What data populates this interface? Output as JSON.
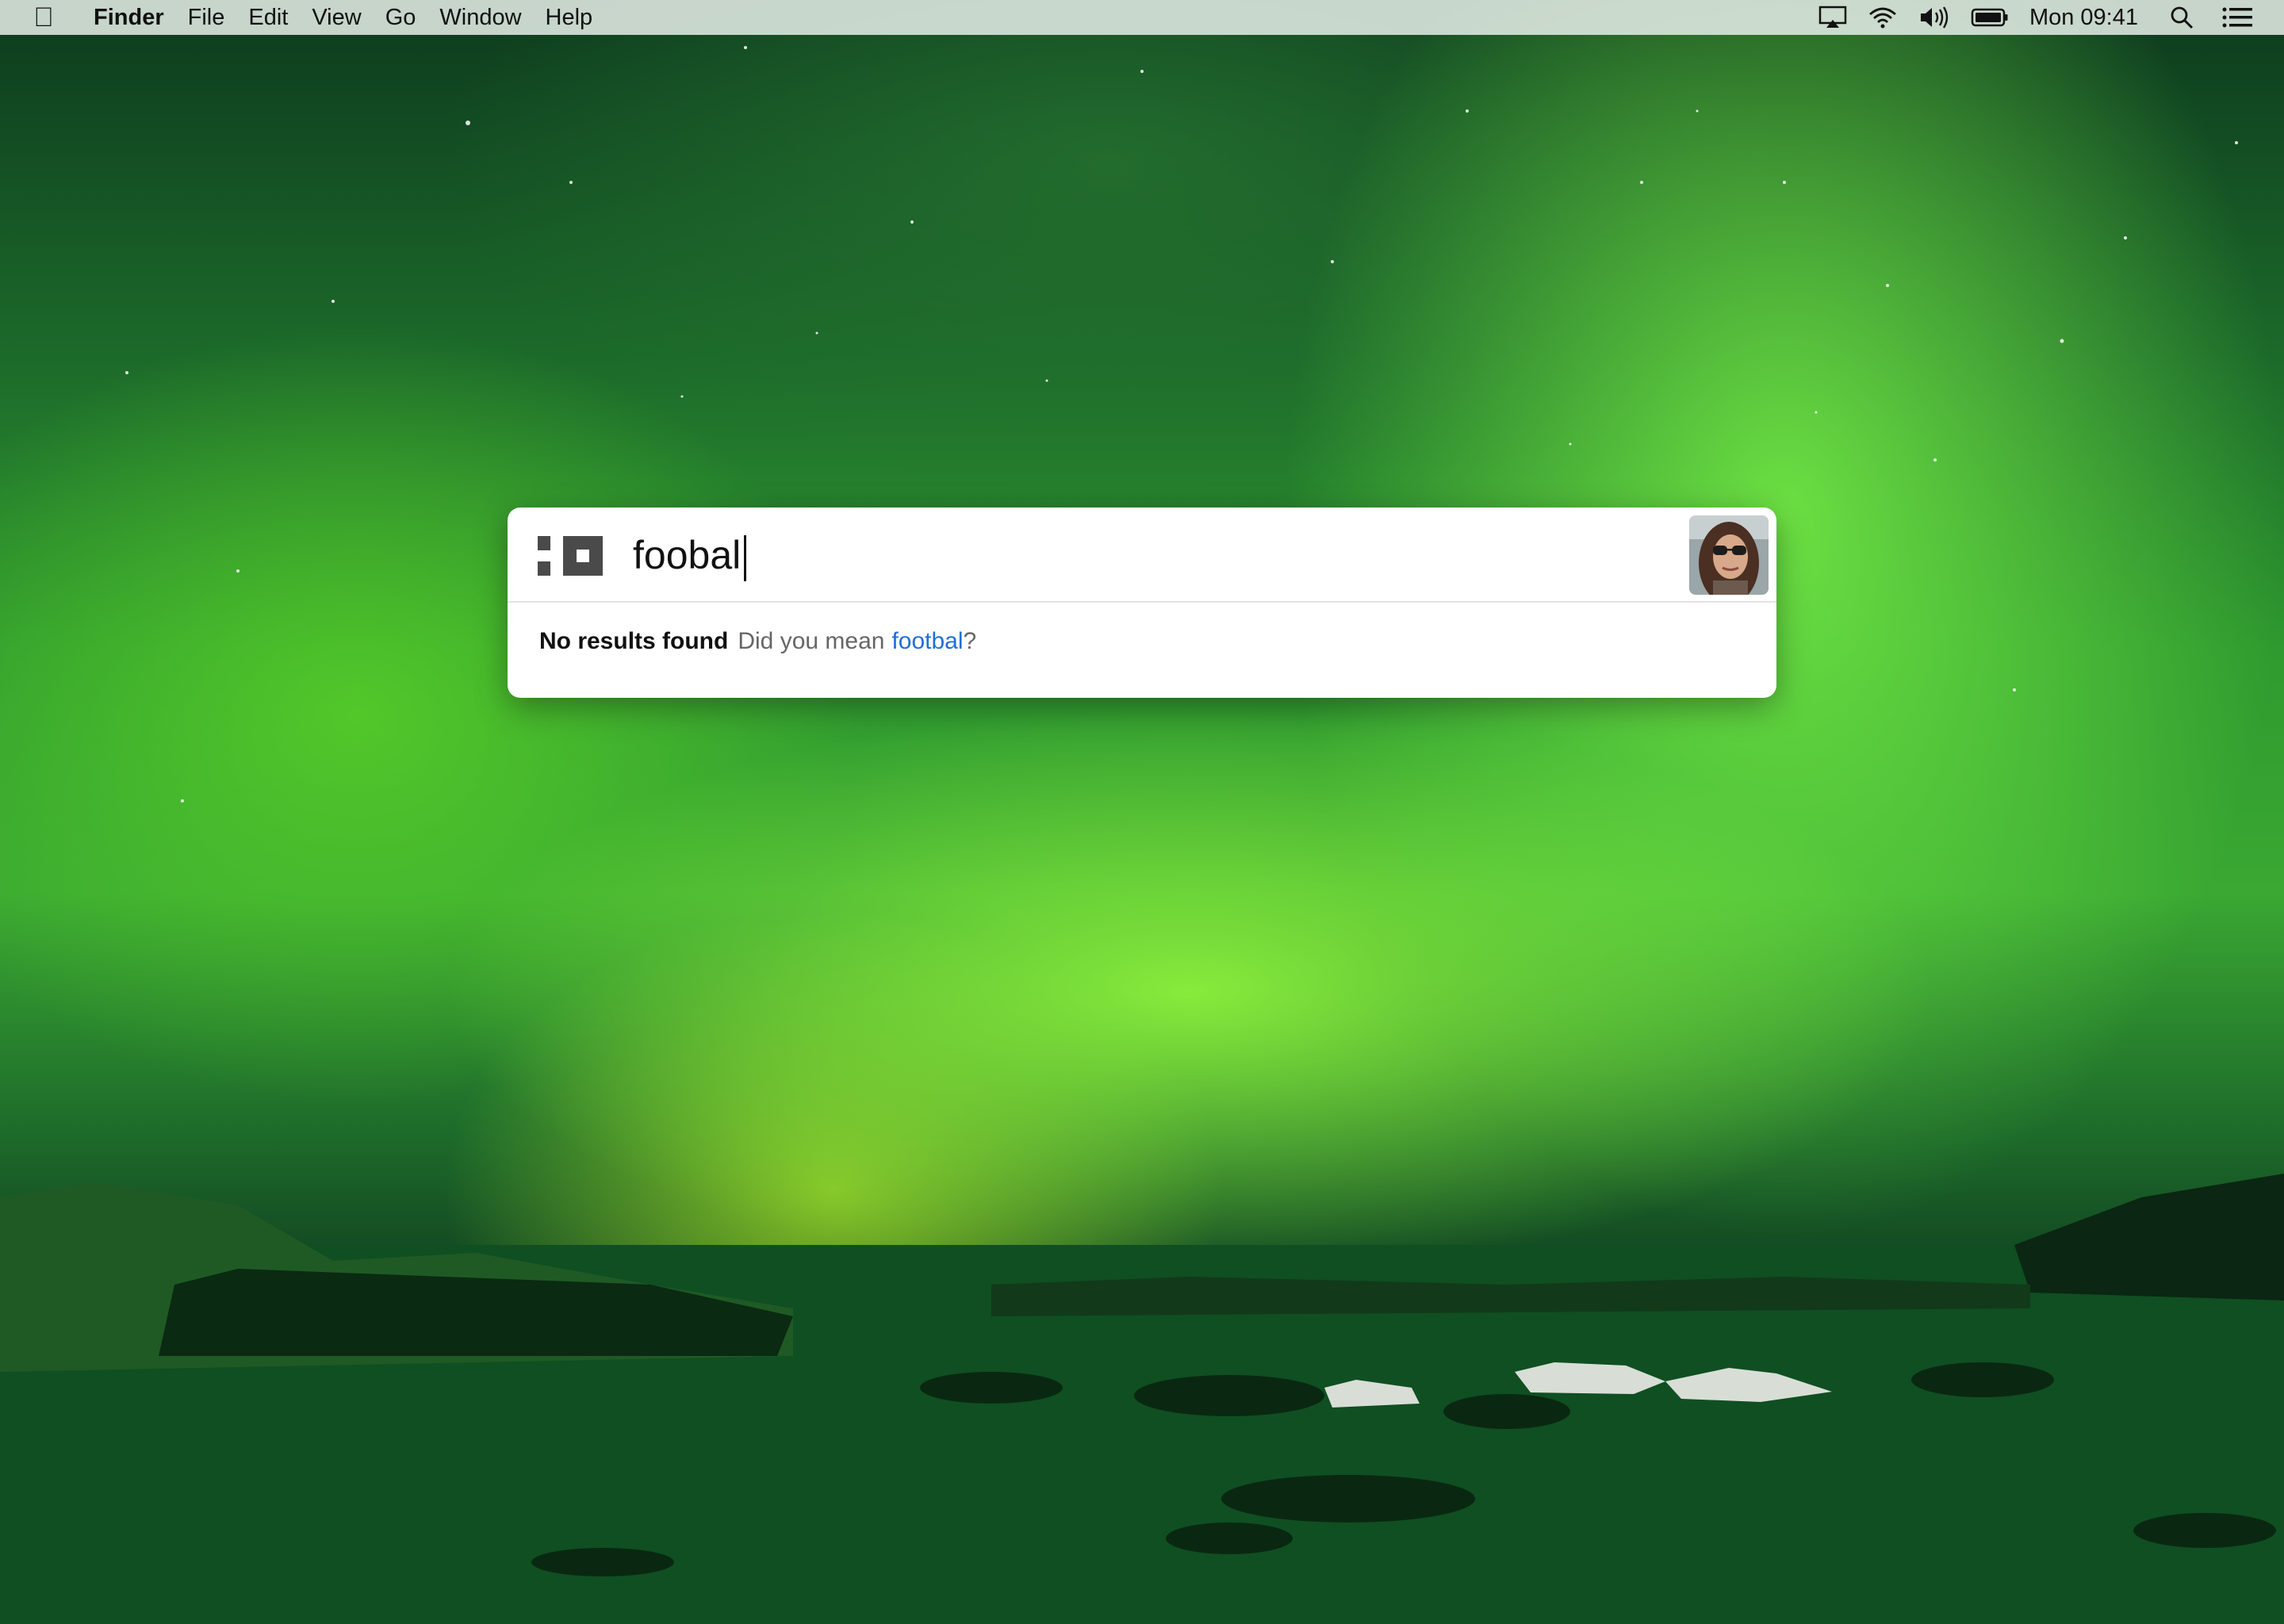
{
  "menubar": {
    "app_name": "Finder",
    "items": [
      "File",
      "Edit",
      "View",
      "Go",
      "Window",
      "Help"
    ],
    "clock": "Mon 09:41",
    "status_icons": [
      "airplay-icon",
      "wifi-icon",
      "volume-icon",
      "battery-icon",
      "spotlight-search-icon",
      "notification-center-icon"
    ]
  },
  "search": {
    "query": "foobal",
    "no_results_label": "No results found",
    "did_you_mean_label": "Did you mean",
    "suggestion": "footbal",
    "suggestion_suffix": "?"
  },
  "colors": {
    "accent": "#1f6fd6",
    "panel_bg": "#ffffff",
    "logo": "#4a4a4a"
  }
}
